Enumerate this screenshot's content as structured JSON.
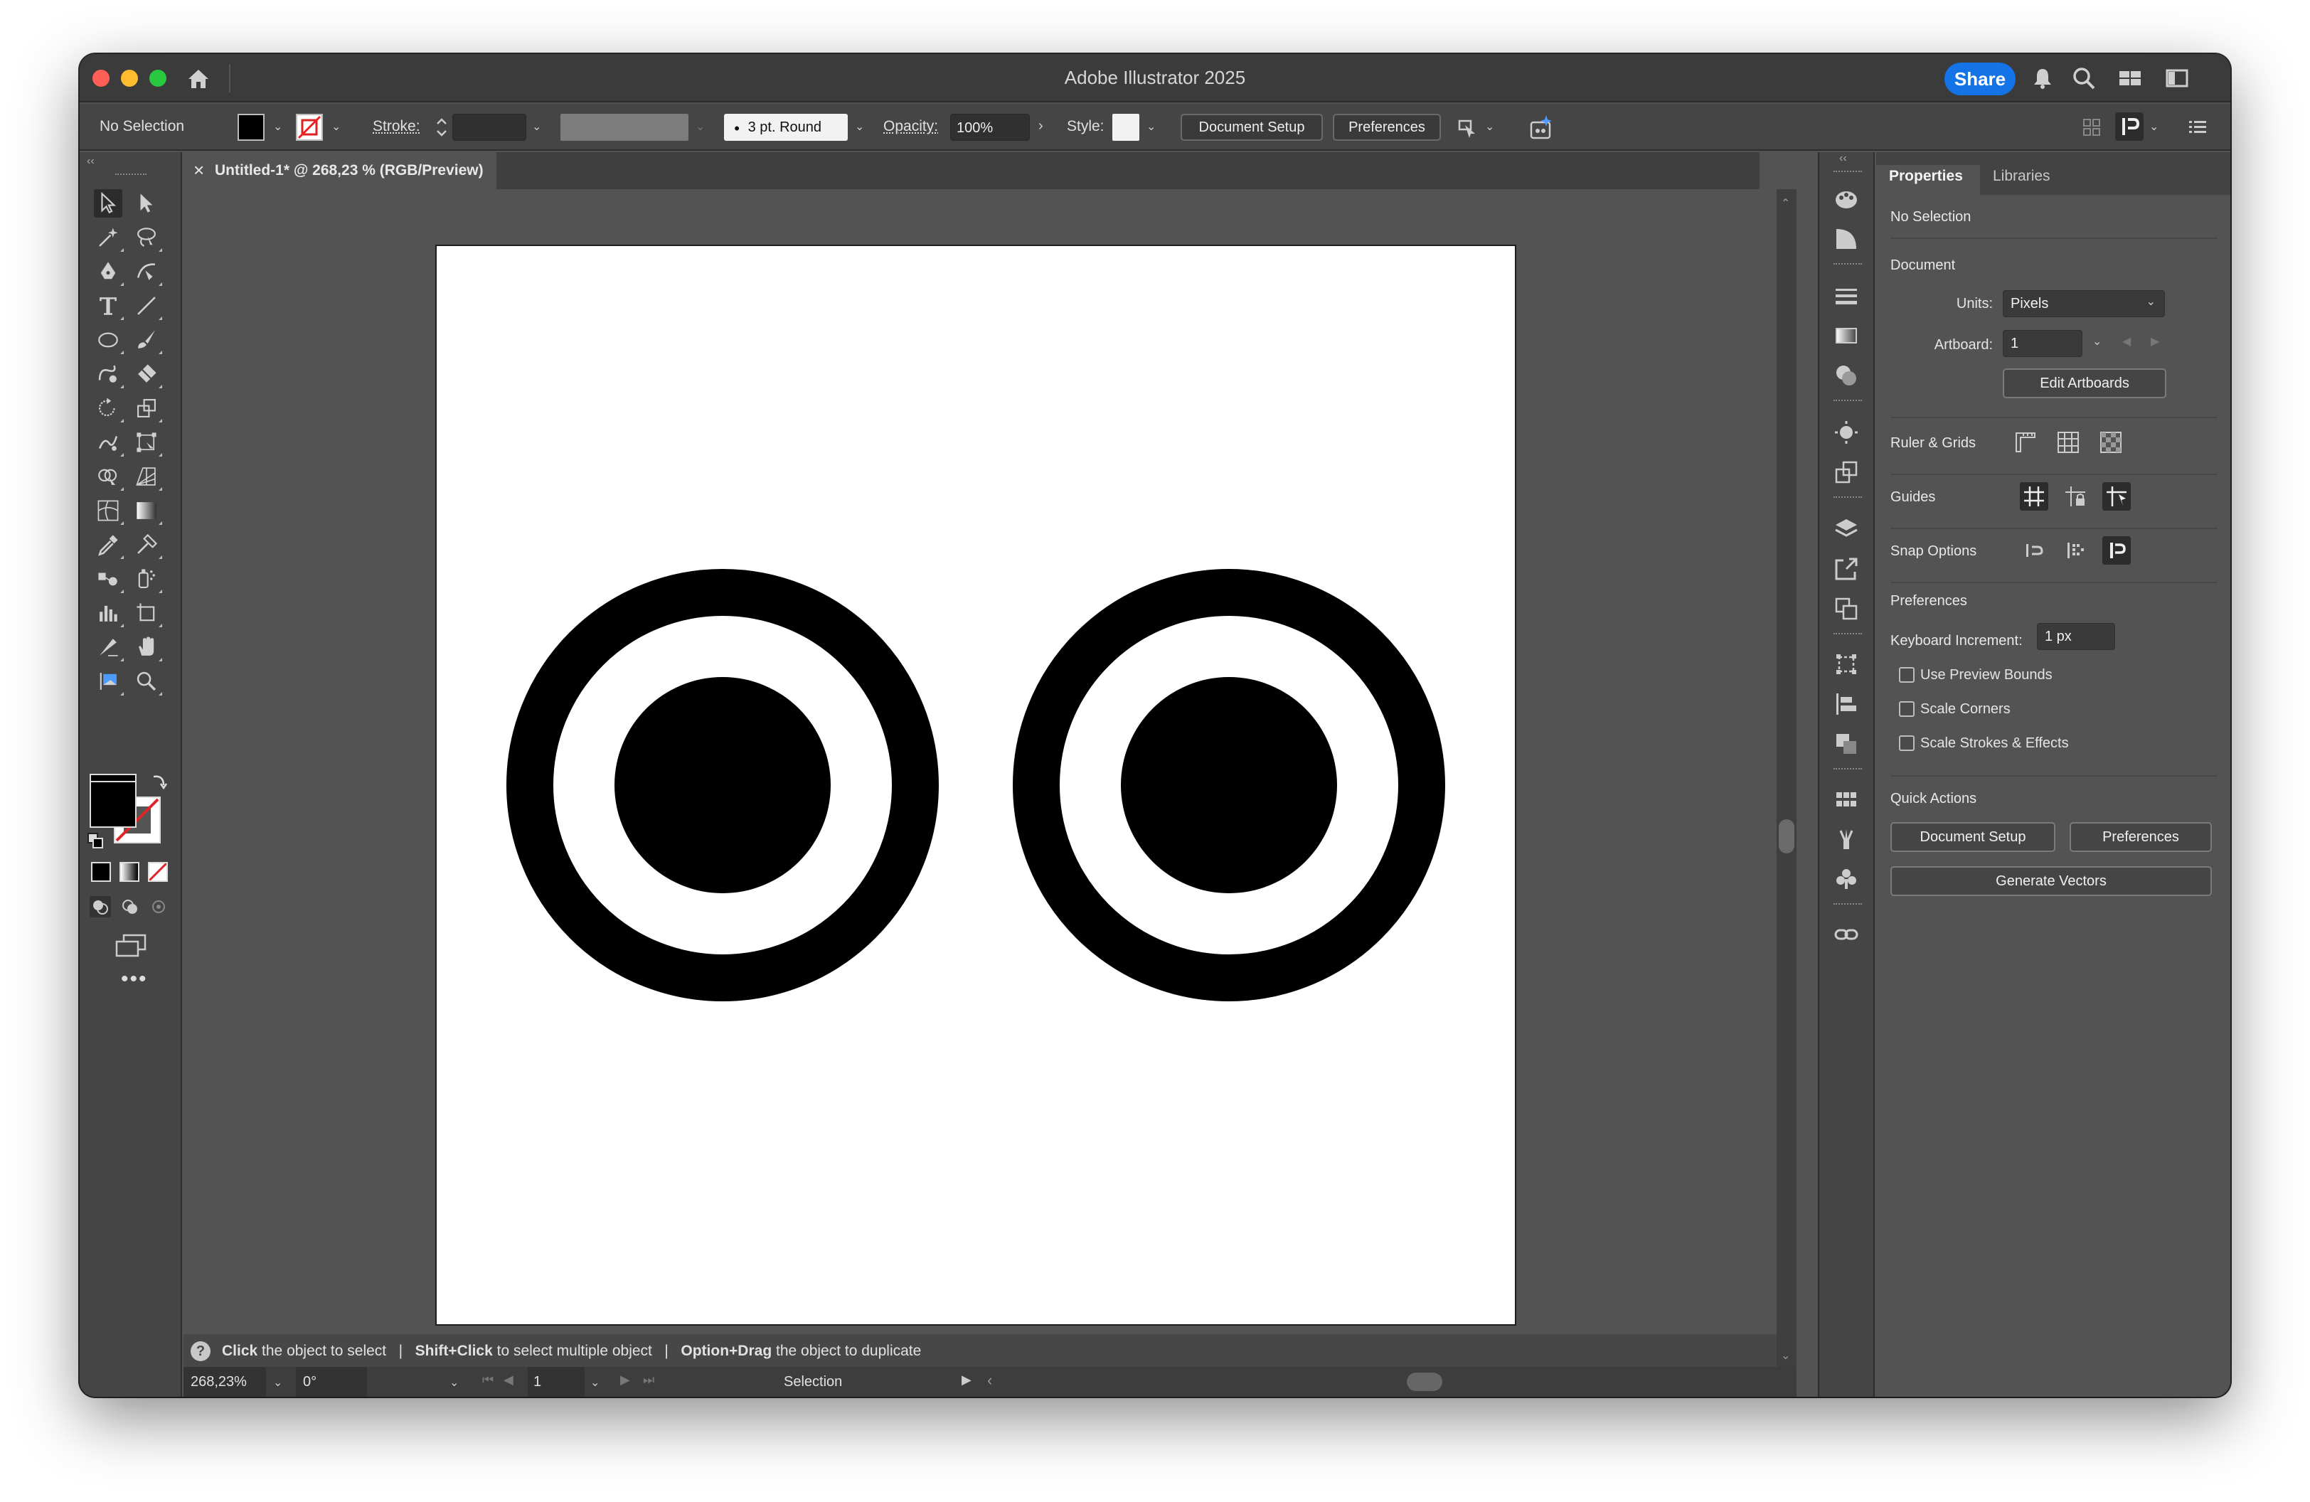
{
  "app": {
    "title": "Adobe Illustrator 2025",
    "share_label": "Share"
  },
  "control_bar": {
    "selection_label": "No Selection",
    "stroke_label": "Stroke:",
    "brush_value": "3 pt. Round",
    "opacity_label": "Opacity:",
    "opacity_value": "100%",
    "style_label": "Style:",
    "document_setup_label": "Document Setup",
    "preferences_label": "Preferences"
  },
  "document_tab": {
    "close_glyph": "×",
    "title": "Untitled-1* @ 268,23 % (RGB/Preview)"
  },
  "status_bar": {
    "hint_parts": [
      {
        "bold": "Click",
        "text": " the object to select"
      },
      {
        "bold": "Shift+Click",
        "text": " to select multiple object"
      },
      {
        "bold": "Option+Drag",
        "text": " the object to duplicate"
      }
    ],
    "separator": "|"
  },
  "bottom_bar": {
    "zoom": "268,23%",
    "rotation": "0°",
    "artboard_number": "1",
    "tool_name": "Selection"
  },
  "properties_panel": {
    "tabs": [
      "Properties",
      "Libraries"
    ],
    "selection_state": "No Selection",
    "document_heading": "Document",
    "units_label": "Units:",
    "units_value": "Pixels",
    "artboard_label": "Artboard:",
    "artboard_value": "1",
    "edit_artboards_label": "Edit Artboards",
    "ruler_grids_label": "Ruler & Grids",
    "guides_label": "Guides",
    "snap_options_label": "Snap Options",
    "preferences_heading": "Preferences",
    "keyboard_increment_label": "Keyboard Increment:",
    "keyboard_increment_value": "1 px",
    "checkboxes": [
      "Use Preview Bounds",
      "Scale Corners",
      "Scale Strokes & Effects"
    ],
    "quick_actions_heading": "Quick Actions",
    "qa_document_setup": "Document Setup",
    "qa_preferences": "Preferences",
    "qa_generate_vectors": "Generate Vectors"
  },
  "colors": {
    "accent": "#1473e6",
    "chrome_dark": "#3b3b3b",
    "panel": "#535353",
    "artboard": "#ffffff",
    "artwork": "#000000"
  },
  "icons": {
    "title_bar": [
      "home-icon",
      "bell-icon",
      "search-icon",
      "workspace-icon",
      "panel-toggle-icon"
    ],
    "tools": [
      "selection-tool-icon",
      "direct-selection-tool-icon",
      "magic-wand-icon",
      "lasso-icon",
      "pen-icon",
      "curvature-icon",
      "type-icon",
      "line-icon",
      "ellipse-icon",
      "paintbrush-icon",
      "shaper-icon",
      "eraser-icon",
      "rotate-icon",
      "scale-icon",
      "warp-icon",
      "free-transform-icon",
      "shape-builder-icon",
      "perspective-grid-icon",
      "mesh-icon",
      "gradient-icon",
      "eyedropper-icon",
      "measure-icon",
      "blend-icon",
      "symbol-sprayer-icon",
      "graph-icon",
      "artboard-tool-icon",
      "slice-icon",
      "hand-icon",
      "print-tiling-icon",
      "zoom-icon"
    ]
  }
}
